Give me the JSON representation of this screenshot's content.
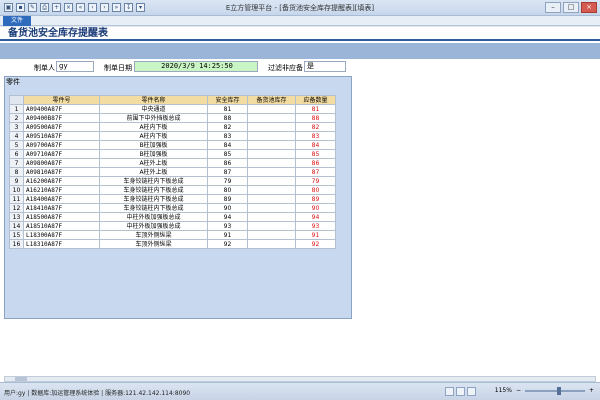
{
  "window": {
    "title": "E立方管理平台 - [备货池安全库存提醒表][填表]"
  },
  "ribbon": {
    "file_tab": "文件"
  },
  "report": {
    "title": "备货池安全库存提醒表"
  },
  "form": {
    "maker_label": "制单人",
    "maker_value": "gy",
    "date_label": "制单日期",
    "date_value": "2020/3/9 14:25:50",
    "filter_label": "过滤非应备",
    "filter_value": "是"
  },
  "section": {
    "label": "零件"
  },
  "table": {
    "headers": [
      "零件号",
      "零件名称",
      "安全库存",
      "备货池库存",
      "应备数量"
    ],
    "rows": [
      {
        "n": "1",
        "code": "A09400A87F",
        "name": "中央通道",
        "safe": "81",
        "pool": "",
        "need": "81"
      },
      {
        "n": "2",
        "code": "A09400B87F",
        "name": "前围下中外挡板总成",
        "safe": "88",
        "pool": "",
        "need": "88"
      },
      {
        "n": "3",
        "code": "A09500A87F",
        "name": "A柱内下板",
        "safe": "82",
        "pool": "",
        "need": "82"
      },
      {
        "n": "4",
        "code": "A09510A87F",
        "name": "A柱内下板",
        "safe": "83",
        "pool": "",
        "need": "83"
      },
      {
        "n": "5",
        "code": "A09700A87F",
        "name": "B柱加强板",
        "safe": "84",
        "pool": "",
        "need": "84"
      },
      {
        "n": "6",
        "code": "A09710A87F",
        "name": "B柱加强板",
        "safe": "85",
        "pool": "",
        "need": "85"
      },
      {
        "n": "7",
        "code": "A09800A87F",
        "name": "A柱外上板",
        "safe": "86",
        "pool": "",
        "need": "86"
      },
      {
        "n": "8",
        "code": "A09810A87F",
        "name": "A柱外上板",
        "safe": "87",
        "pool": "",
        "need": "87"
      },
      {
        "n": "9",
        "code": "A16200A87F",
        "name": "车身铰链柱内下板总成",
        "safe": "79",
        "pool": "",
        "need": "79"
      },
      {
        "n": "10",
        "code": "A16210A87F",
        "name": "车身铰链柱内下板总成",
        "safe": "80",
        "pool": "",
        "need": "80"
      },
      {
        "n": "11",
        "code": "A18400A87F",
        "name": "车身铰链柱内下板总成",
        "safe": "89",
        "pool": "",
        "need": "89"
      },
      {
        "n": "12",
        "code": "A18410A87F",
        "name": "车身铰链柱内下板总成",
        "safe": "90",
        "pool": "",
        "need": "90"
      },
      {
        "n": "13",
        "code": "A18500A87F",
        "name": "中柱外板加强板总成",
        "safe": "94",
        "pool": "",
        "need": "94"
      },
      {
        "n": "14",
        "code": "A18510A87F",
        "name": "中柱外板加强板总成",
        "safe": "93",
        "pool": "",
        "need": "93"
      },
      {
        "n": "15",
        "code": "L18300A87F",
        "name": "车顶外侧纵梁",
        "safe": "91",
        "pool": "",
        "need": "91"
      },
      {
        "n": "16",
        "code": "L18310A87F",
        "name": "车顶外侧纵梁",
        "safe": "92",
        "pool": "",
        "need": "92"
      }
    ]
  },
  "status": {
    "text": "用户:gy | 数据库:加运管理系统体验 | 服务器:121.42.142.114:8090",
    "zoom": "115%"
  }
}
